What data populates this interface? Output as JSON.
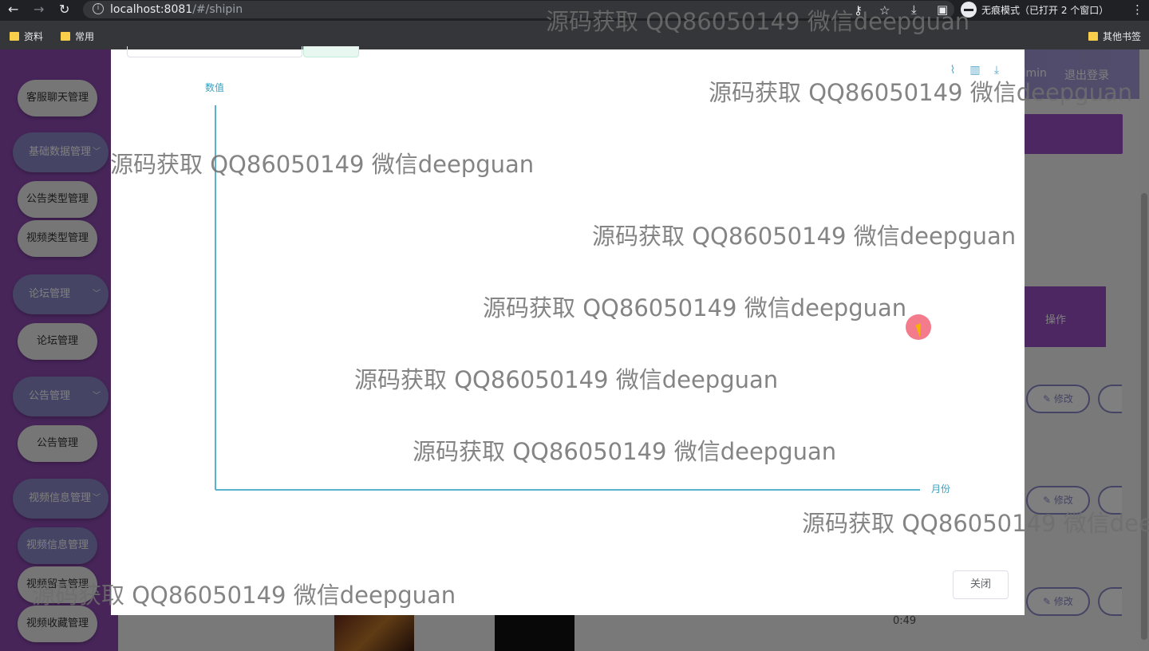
{
  "browser": {
    "url_host": "localhost:8081",
    "url_path": "/#/shipin",
    "incognito_label": "无痕模式（已打开 2 个窗口）",
    "bookmarks": [
      "资料",
      "常用"
    ],
    "other_bookmarks": "其他书签"
  },
  "app": {
    "header_links": [
      "admin",
      "退出登录"
    ],
    "sidebar": {
      "groups": [
        {
          "label": "客服聊天管理"
        },
        {
          "label": "基础数据管理"
        },
        {
          "label": "论坛管理"
        },
        {
          "label": "公告管理"
        },
        {
          "label": "视频信息管理"
        }
      ],
      "items": [
        "公告类型管理",
        "视频类型管理",
        "论坛管理",
        "公告管理",
        "视频信息管理",
        "视频留言管理",
        "视频收藏管理"
      ]
    },
    "table": {
      "op_header": "操作",
      "edit_label": "修改",
      "duration": "0:49"
    }
  },
  "modal": {
    "close_label": "关闭",
    "tools": [
      "line-chart-icon",
      "bar-chart-icon",
      "download-icon"
    ]
  },
  "chart_data": {
    "type": "line",
    "categories": [],
    "series": [],
    "xlabel": "月份",
    "ylabel": "数值"
  },
  "watermark": "源码获取 QQ86050149 微信deepguan"
}
